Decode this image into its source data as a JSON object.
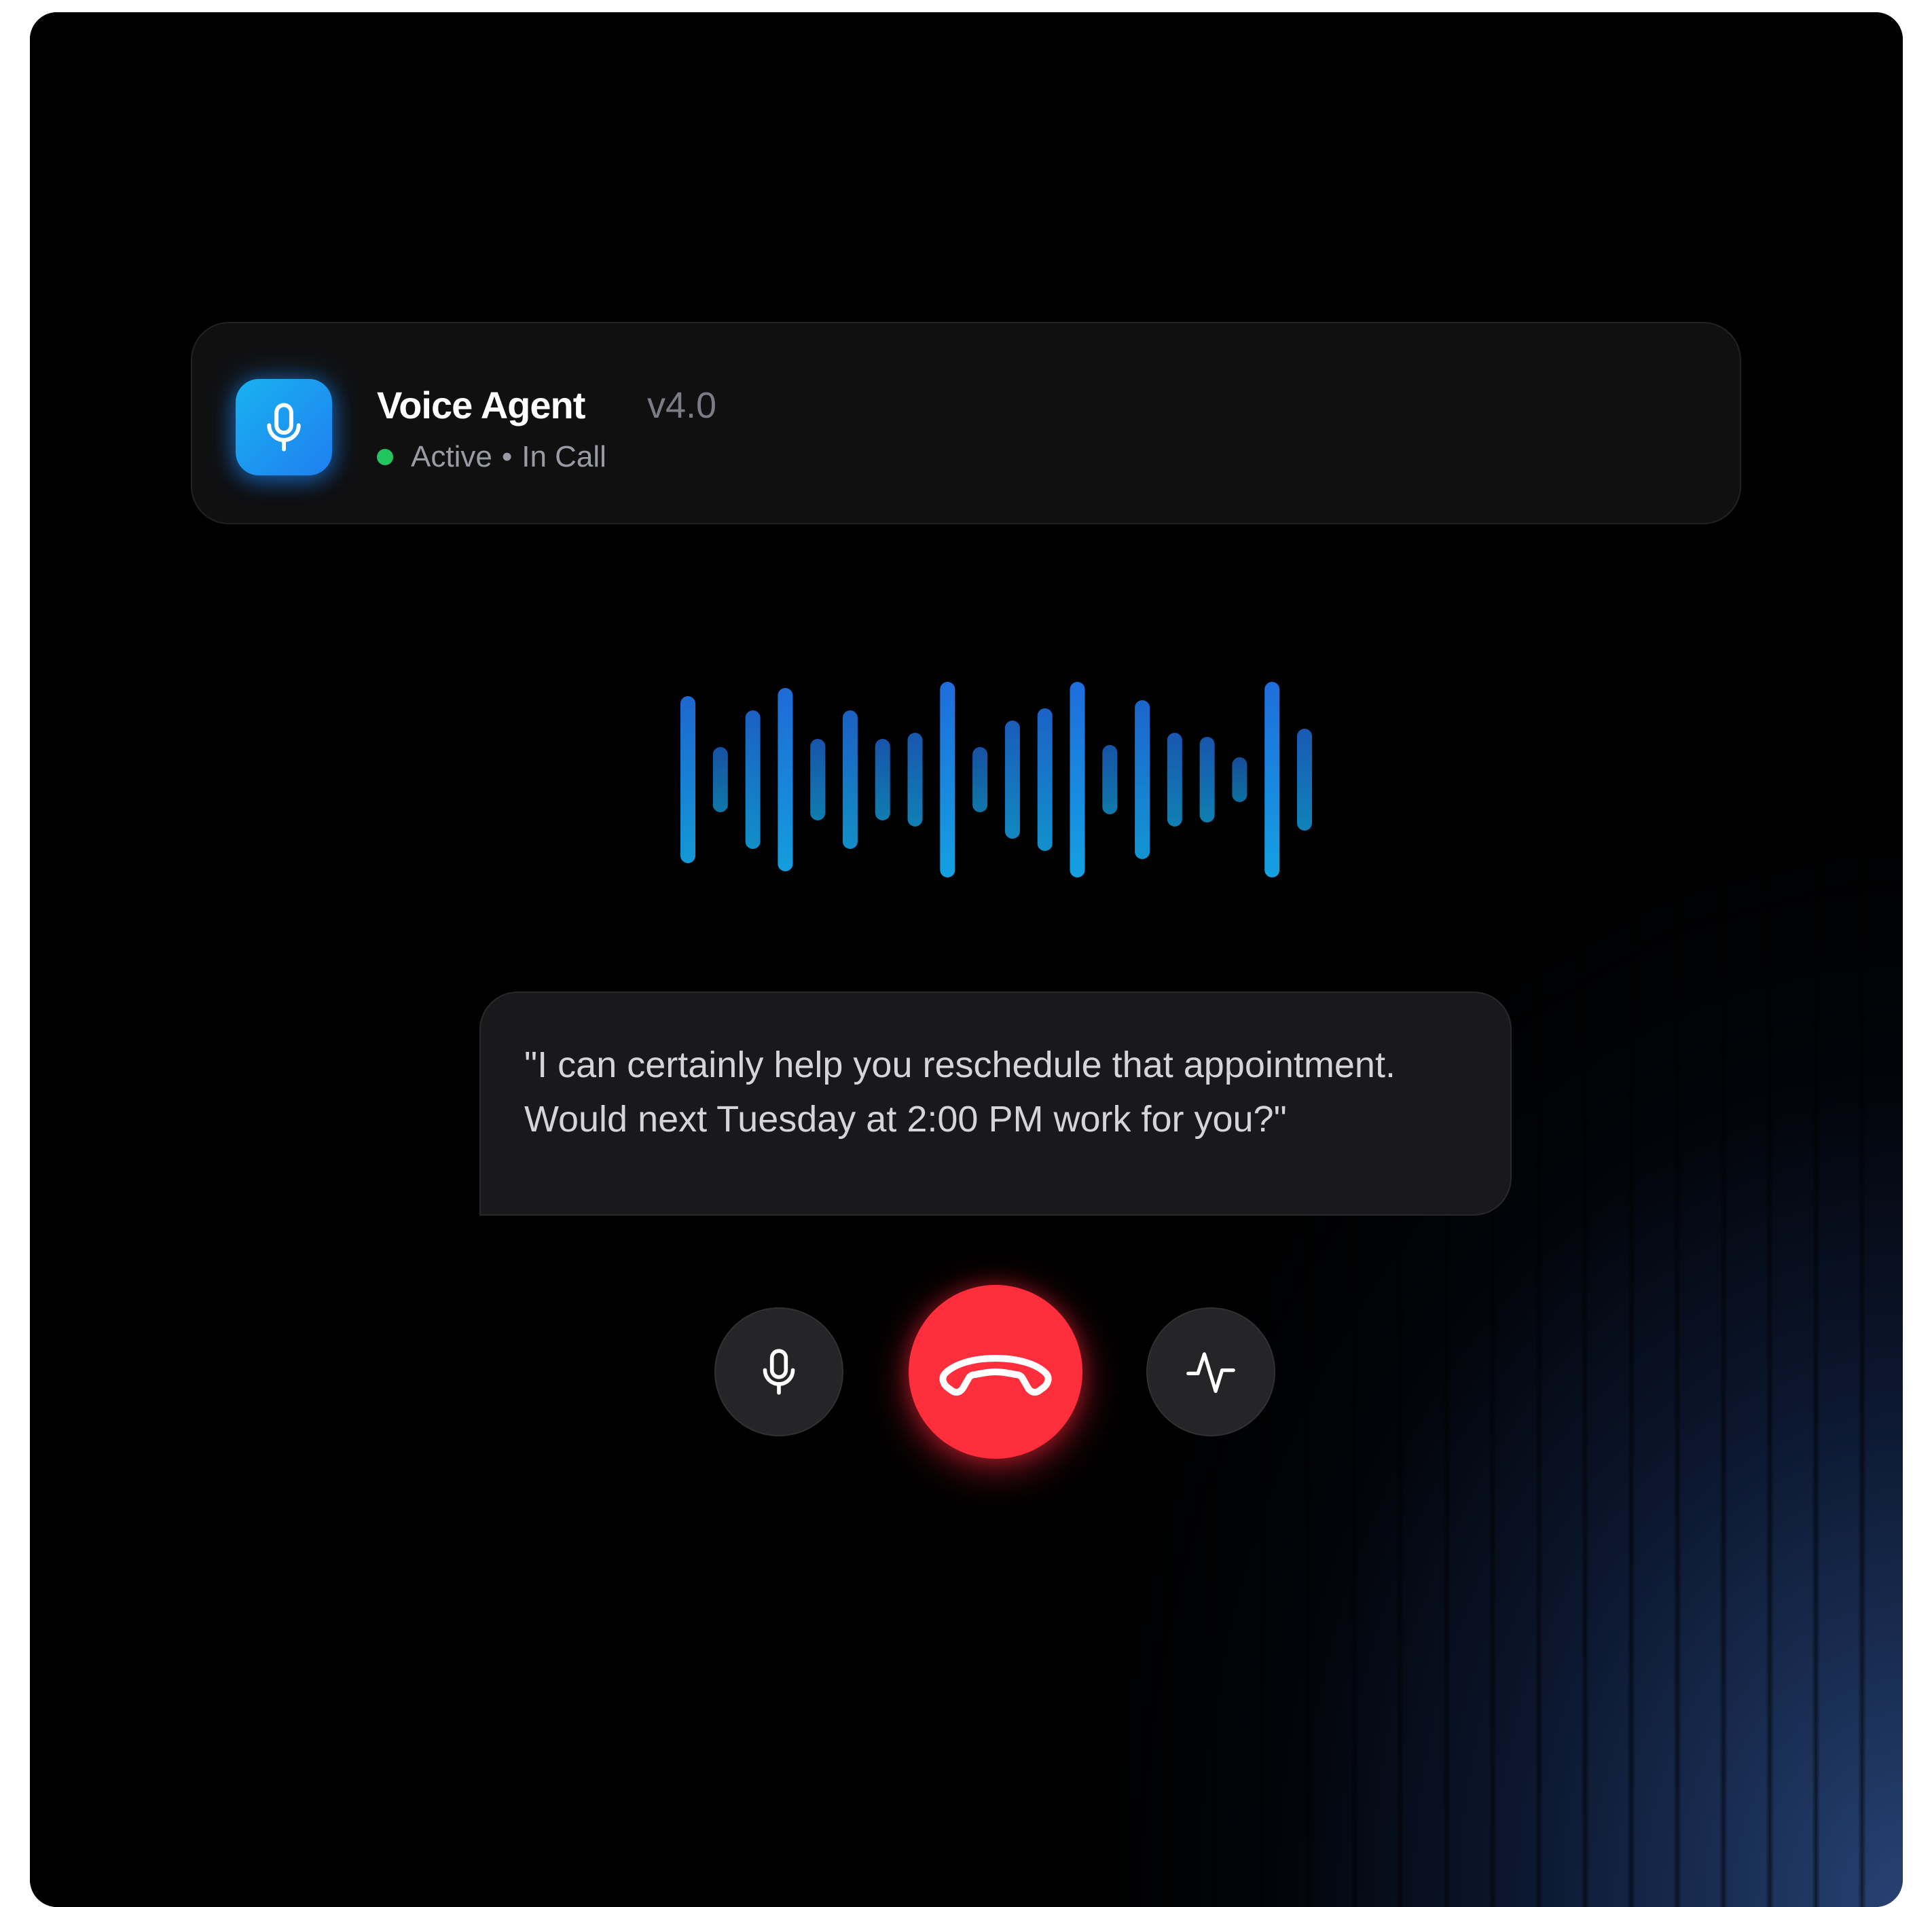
{
  "header": {
    "title": "Voice Agent",
    "version": "v4.0",
    "status": "Active",
    "separator": "•",
    "call_state": "In Call",
    "status_color": "#22c55e",
    "icon": "microphone-icon"
  },
  "waveform": {
    "bar_levels": [
      0.82,
      0.32,
      0.68,
      0.9,
      0.4,
      0.68,
      0.4,
      0.46,
      0.96,
      0.32,
      0.58,
      0.7,
      0.96,
      0.34,
      0.78,
      0.46,
      0.42,
      0.22,
      0.96,
      0.5
    ],
    "colors": [
      "#1f6fe0",
      "#1aa0e8"
    ]
  },
  "transcript": {
    "text": "\"I can certainly help you reschedule that appointment. Would next Tuesday at 2:00 PM work for you?\""
  },
  "controls": {
    "mic_icon": "microphone-icon",
    "end_call_icon": "phone-hangup-icon",
    "end_call_color": "#ff2e3c",
    "activity_icon": "activity-pulse-icon"
  }
}
